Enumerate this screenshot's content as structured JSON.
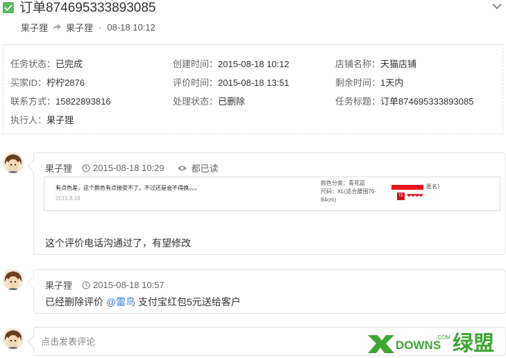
{
  "header": {
    "order_title": "订单874695333893085",
    "crumb_from": "果子狸",
    "crumb_to": "果子狸",
    "crumb_sep": "·",
    "crumb_time": "08-18 10:12"
  },
  "info": {
    "task_status": {
      "label": "任务状态：",
      "value": "已完成"
    },
    "created_time": {
      "label": "创建时间：",
      "value": "2015-08-18 10:12"
    },
    "shop_name": {
      "label": "店铺名称：",
      "value": "天猫店铺"
    },
    "buyer_id": {
      "label": "买家ID：",
      "value": "柠柠2876"
    },
    "review_time": {
      "label": "评价时间：",
      "value": "2015-08-18 13:51"
    },
    "remaining_time": {
      "label": "剩余时间：",
      "value": "1天内"
    },
    "contact": {
      "label": "联系方式：",
      "value": "15822893816"
    },
    "process_status": {
      "label": "处理状态：",
      "value": "已删除"
    },
    "task_title": {
      "label": "任务标题：",
      "value": "订单874695333893085"
    },
    "executor": {
      "label": "执行人：",
      "value": "果子狸"
    }
  },
  "comments": [
    {
      "author": "果子狸",
      "time": "2015-08-18 10:29",
      "read_status": "都已读",
      "review": {
        "text": "有点色差，这个颜色有点接受不了。不过还是会不得换。。。",
        "date": "2015.8.18",
        "spec": "颜色分类：青花蓝\n尺码：XL(适合腰围76-84cm)",
        "anon": "匿名）",
        "tag": "TE",
        "hearts": "❤❤❤❤"
      },
      "text": "这个评价电话沟通过了，有望修改"
    },
    {
      "author": "果子狸",
      "time": "2015-08-18 10:57",
      "text_before": "已经删除评价 ",
      "mention": "@雷鸟",
      "text_after": " 支付宝红包5元送给客户"
    }
  ],
  "compose": {
    "placeholder": "点击发表评论"
  },
  "watermark": {
    "text_dl": "DOWNS",
    "text_com": ".COM",
    "text_cn": "绿盟"
  },
  "colors": {
    "success": "#5cb85c",
    "mention": "#3a7bd5",
    "watermark_green": "#3fa535"
  }
}
